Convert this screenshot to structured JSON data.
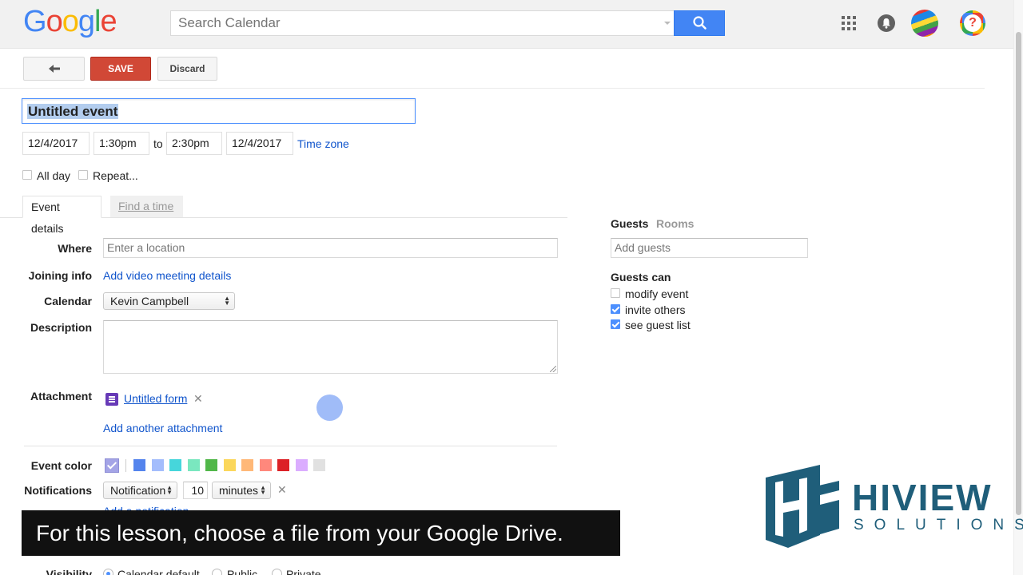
{
  "header": {
    "search_placeholder": "Search Calendar",
    "icons": [
      "apps-icon",
      "notifications-bell-icon",
      "account-avatar",
      "help-icon"
    ]
  },
  "toolbar": {
    "save_label": "SAVE",
    "discard_label": "Discard"
  },
  "event": {
    "title": "Untitled event",
    "start_date": "12/4/2017",
    "start_time": "1:30pm",
    "to_label": "to",
    "end_time": "2:30pm",
    "end_date": "12/4/2017",
    "time_zone_link": "Time zone",
    "all_day_label": "All day",
    "repeat_label": "Repeat..."
  },
  "tabs": {
    "details": "Event details",
    "find_time": "Find a time"
  },
  "details": {
    "where_label": "Where",
    "where_placeholder": "Enter a location",
    "joining_label": "Joining info",
    "joining_link": "Add video meeting details",
    "calendar_label": "Calendar",
    "calendar_value": "Kevin Campbell",
    "description_label": "Description",
    "attachment_label": "Attachment",
    "attachment_name": "Untitled form",
    "add_attachment_link": "Add another attachment",
    "color_label": "Event color",
    "colors": [
      "#a4a4e6",
      "#5484ed",
      "#a4bdfc",
      "#46d6db",
      "#7ae7bf",
      "#51b749",
      "#fbd75b",
      "#ffb878",
      "#ff887c",
      "#dc2127",
      "#dbadff",
      "#e1e1e1"
    ],
    "notifications_label": "Notifications",
    "notification_type": "Notification",
    "notification_amount": "10",
    "notification_unit": "minutes",
    "add_notification_link": "Add a notification",
    "visibility_label": "Visibility",
    "visibility_options": [
      "Calendar default",
      "Public",
      "Private"
    ]
  },
  "guests": {
    "tab_guests": "Guests",
    "tab_rooms": "Rooms",
    "add_placeholder": "Add guests",
    "can_heading": "Guests can",
    "permissions": [
      {
        "label": "modify event",
        "checked": false
      },
      {
        "label": "invite others",
        "checked": true
      },
      {
        "label": "see guest list",
        "checked": true
      }
    ]
  },
  "caption": "For this lesson, choose a file from your Google Drive.",
  "watermark": {
    "brand": "HIVIEW",
    "sub": "SOLUTIONS",
    "color": "#1f5e7a"
  }
}
